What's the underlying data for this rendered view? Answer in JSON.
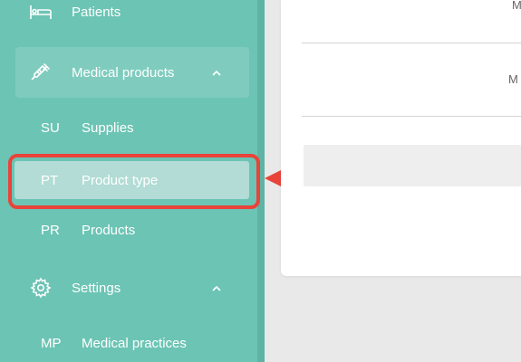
{
  "sidebar": {
    "items": [
      {
        "label": "Patients",
        "icon": "bed-icon"
      },
      {
        "label": "Medical products",
        "icon": "syringe-icon",
        "expanded": true
      },
      {
        "abbr": "SU",
        "label": "Supplies"
      },
      {
        "abbr": "PT",
        "label": "Product type",
        "active": true
      },
      {
        "abbr": "PR",
        "label": "Products"
      },
      {
        "label": "Settings",
        "icon": "gear-icon",
        "expanded": true
      },
      {
        "abbr": "MP",
        "label": "Medical practices"
      }
    ]
  },
  "main": {
    "row1_text": "M",
    "row2_text": "M"
  },
  "annotation": {
    "highlight_color": "#e8443a",
    "arrow": "arrow-left-icon"
  },
  "colors": {
    "sidebar": "#6cc4b4",
    "active_item": "#b2dcd5"
  }
}
